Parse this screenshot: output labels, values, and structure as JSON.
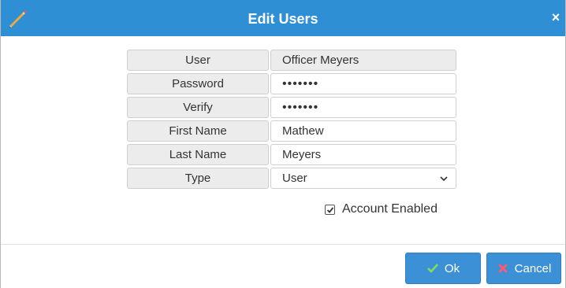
{
  "dialog": {
    "title": "Edit Users",
    "close_label": "×",
    "title_icon": "pencil-icon",
    "close_icon": "close-icon",
    "accent_color": "#2f8fd4"
  },
  "form": {
    "fields": [
      {
        "label": "User",
        "value": "Officer Meyers",
        "readonly": true
      },
      {
        "label": "Password",
        "value": "•••••••"
      },
      {
        "label": "Verify",
        "value": "•••••••"
      },
      {
        "label": "First Name",
        "value": "Mathew"
      },
      {
        "label": "Last Name",
        "value": "Meyers"
      },
      {
        "label": "Type",
        "value": "User",
        "dropdown": true
      }
    ],
    "account_enabled": {
      "label": "Account Enabled",
      "checked": true
    }
  },
  "buttons": {
    "ok_label": "Ok",
    "ok_icon": "check-icon",
    "cancel_label": "Cancel",
    "cancel_icon": "x-icon",
    "button_color": "#3c91d6"
  }
}
